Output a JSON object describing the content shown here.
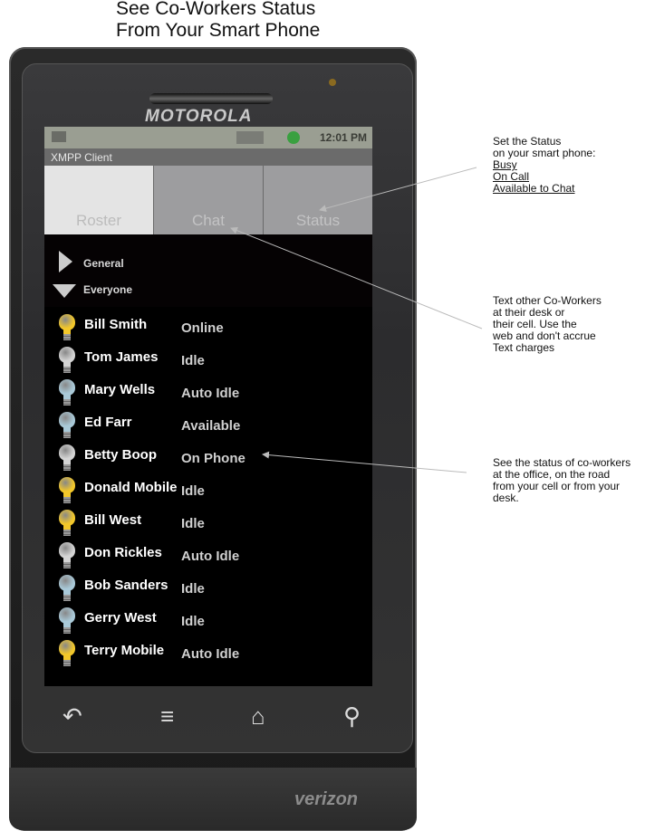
{
  "title": {
    "line1": "See Co-Workers Status",
    "line2": "From Your Smart Phone"
  },
  "device": {
    "brand": "MOTOROLA",
    "carrier": "verizon"
  },
  "statusbar": {
    "time": "12:01 PM"
  },
  "app": {
    "title": "XMPP Client"
  },
  "tabs": [
    {
      "label": "Roster",
      "active": true
    },
    {
      "label": "Chat",
      "active": false
    },
    {
      "label": "Status",
      "active": false
    }
  ],
  "groups": [
    {
      "label": "General",
      "expanded": false
    },
    {
      "label": "Everyone",
      "expanded": true
    }
  ],
  "roster": [
    {
      "name": "Bill Smith",
      "status": "Online",
      "bulb": "yellow"
    },
    {
      "name": "Tom James",
      "status": "Idle",
      "bulb": "white"
    },
    {
      "name": "Mary Wells",
      "status": "Auto Idle",
      "bulb": "blue"
    },
    {
      "name": "Ed Farr",
      "status": "Available",
      "bulb": "blue"
    },
    {
      "name": "Betty Boop",
      "status": "On Phone",
      "bulb": "white"
    },
    {
      "name": "Donald Mobile",
      "status": "Idle",
      "bulb": "yellow"
    },
    {
      "name": "Bill West",
      "status": "Idle",
      "bulb": "yellow"
    },
    {
      "name": "Don Rickles",
      "status": "Auto Idle",
      "bulb": "white"
    },
    {
      "name": "Bob Sanders",
      "status": "Idle",
      "bulb": "blue"
    },
    {
      "name": "Gerry West",
      "status": "Idle",
      "bulb": "blue"
    },
    {
      "name": "Terry Mobile",
      "status": "Auto Idle",
      "bulb": "yellow"
    }
  ],
  "bulb_colors": {
    "yellow": "#f2c72a",
    "white": "#d4d4d4",
    "blue": "#a9c9d8"
  },
  "navkeys": [
    {
      "name": "back",
      "glyph": "↶"
    },
    {
      "name": "menu",
      "glyph": "≡"
    },
    {
      "name": "home",
      "glyph": "⌂"
    },
    {
      "name": "search",
      "glyph": "⚲"
    }
  ],
  "notes": {
    "status": {
      "line1": "Set the Status",
      "line2": "on your smart phone:",
      "options": [
        "Busy",
        "On Call",
        "Available to Chat"
      ]
    },
    "chat": [
      "Text other Co-Workers",
      "at their desk or",
      "their cell.  Use the",
      "web and don't accrue",
      "Text charges"
    ],
    "roster": [
      "See the status of co-workers",
      "at the office, on the road",
      "from your cell or from your",
      "desk."
    ]
  }
}
